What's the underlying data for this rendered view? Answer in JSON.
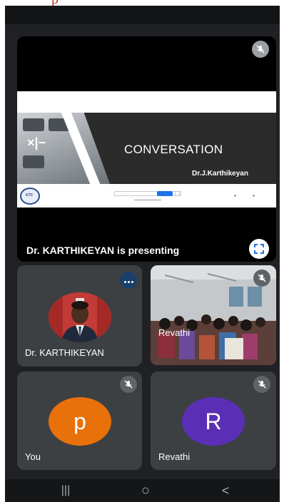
{
  "header_fragment": "p",
  "presentation": {
    "slide_title": "CONVERSATION",
    "slide_author": "Dr.J.Karthikeyan",
    "slide_logo_text": "KTC",
    "slide_glyph": "×|−",
    "presenting_label": "Dr. KARTHIKEYAN is presenting",
    "fullscreen_icon": "fullscreen-icon",
    "mute_icon": "mic-off-icon"
  },
  "participants": [
    {
      "name": "Dr. KARTHIKEYAN",
      "tile": "photo",
      "menu_icon": "more-options-icon"
    },
    {
      "name": "Revathi",
      "tile": "video",
      "mute_icon": "mic-off-icon"
    },
    {
      "name": "You",
      "initial": "p",
      "avatar_color": "#e8710a",
      "mute_icon": "mic-off-icon"
    },
    {
      "name": "Revathi",
      "initial": "R",
      "avatar_color": "#5b2fb5",
      "mute_icon": "mic-off-icon"
    }
  ],
  "navigation": {
    "recents": "|||",
    "home": "○",
    "back": "<"
  },
  "colors": {
    "background": "#202124",
    "tile": "#3c4043",
    "accent": "#1a73e8"
  }
}
